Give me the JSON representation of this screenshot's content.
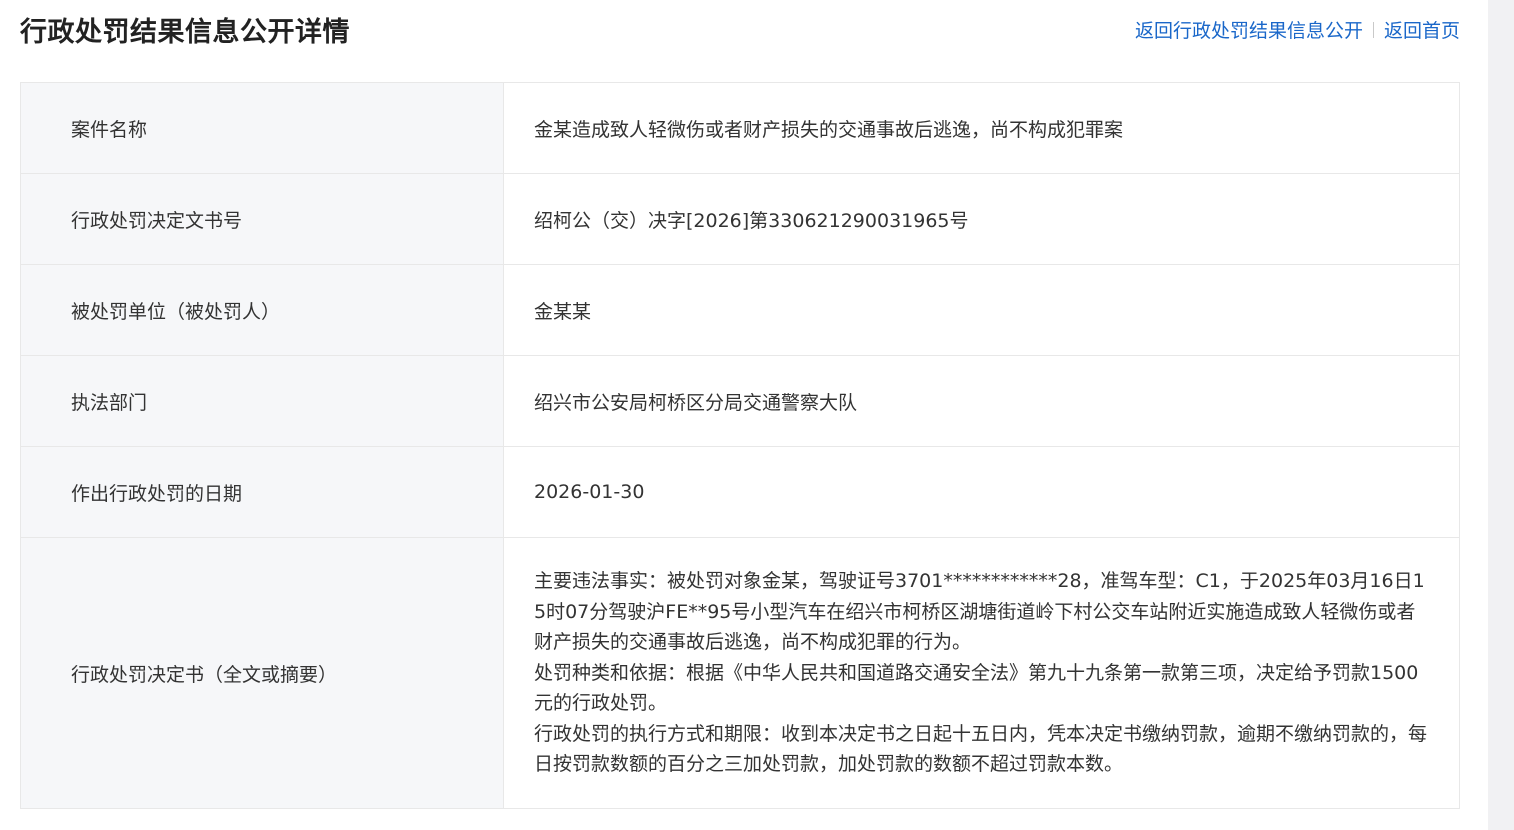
{
  "header": {
    "title": "行政处罚结果信息公开详情",
    "links": {
      "back_list": "返回行政处罚结果信息公开",
      "back_home": "返回首页"
    }
  },
  "rows": [
    {
      "label": "案件名称",
      "value": "金某造成致人轻微伤或者财产损失的交通事故后逃逸，尚不构成犯罪案"
    },
    {
      "label": "行政处罚决定文书号",
      "value": "绍柯公（交）决字[2026]第330621290031965号"
    },
    {
      "label": "被处罚单位（被处罚人）",
      "value": "金某某"
    },
    {
      "label": "执法部门",
      "value": "绍兴市公安局柯桥区分局交通警察大队"
    },
    {
      "label": "作出行政处罚的日期",
      "value": "2026-01-30"
    }
  ],
  "decision": {
    "label": "行政处罚决定书（全文或摘要）",
    "paragraphs": [
      "主要违法事实：被处罚对象金某，驾驶证号3701************28，准驾车型：C1，于2025年03月16日15时07分驾驶沪FE**95号小型汽车在绍兴市柯桥区湖塘街道岭下村公交车站附近实施造成致人轻微伤或者财产损失的交通事故后逃逸，尚不构成犯罪的行为。",
      "处罚种类和依据：根据《中华人民共和国道路交通安全法》第九十九条第一款第三项，决定给予罚款1500元的行政处罚。",
      "行政处罚的执行方式和期限：收到本决定书之日起十五日内，凭本决定书缴纳罚款，逾期不缴纳罚款的，每日按罚款数额的百分之三加处罚款，加处罚款的数额不超过罚款本数。"
    ]
  }
}
